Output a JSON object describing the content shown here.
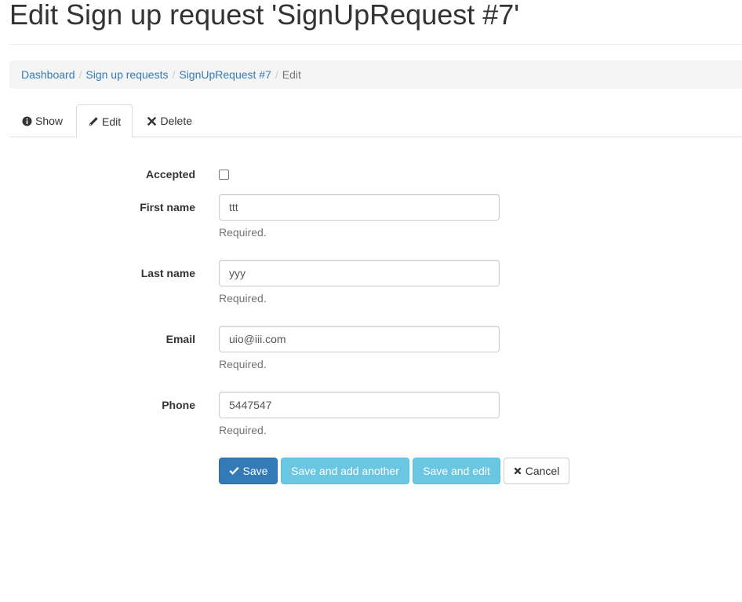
{
  "page": {
    "title": "Edit Sign up request 'SignUpRequest #7'"
  },
  "breadcrumb": {
    "items": [
      "Dashboard",
      "Sign up requests",
      "SignUpRequest #7"
    ],
    "current": "Edit",
    "separator": "/"
  },
  "tabs": [
    {
      "label": "Show",
      "icon": "info-circle-icon"
    },
    {
      "label": "Edit",
      "icon": "pencil-icon",
      "active": true
    },
    {
      "label": "Delete",
      "icon": "times-icon"
    }
  ],
  "form": {
    "accepted": {
      "label": "Accepted",
      "checked": false
    },
    "first_name": {
      "label": "First name",
      "value": "ttt",
      "help": "Required."
    },
    "last_name": {
      "label": "Last name",
      "value": "yyy",
      "help": "Required."
    },
    "email": {
      "label": "Email",
      "value": "uio@iii.com",
      "help": "Required."
    },
    "phone": {
      "label": "Phone",
      "value": "5447547",
      "help": "Required."
    }
  },
  "buttons": {
    "save": "Save",
    "save_add_another": "Save and add another",
    "save_edit": "Save and edit",
    "cancel": "Cancel"
  },
  "colors": {
    "link": "#337ab7",
    "primary": "#337ab7",
    "info": "#5bc0de",
    "breadcrumb_bg": "#f5f5f5"
  }
}
